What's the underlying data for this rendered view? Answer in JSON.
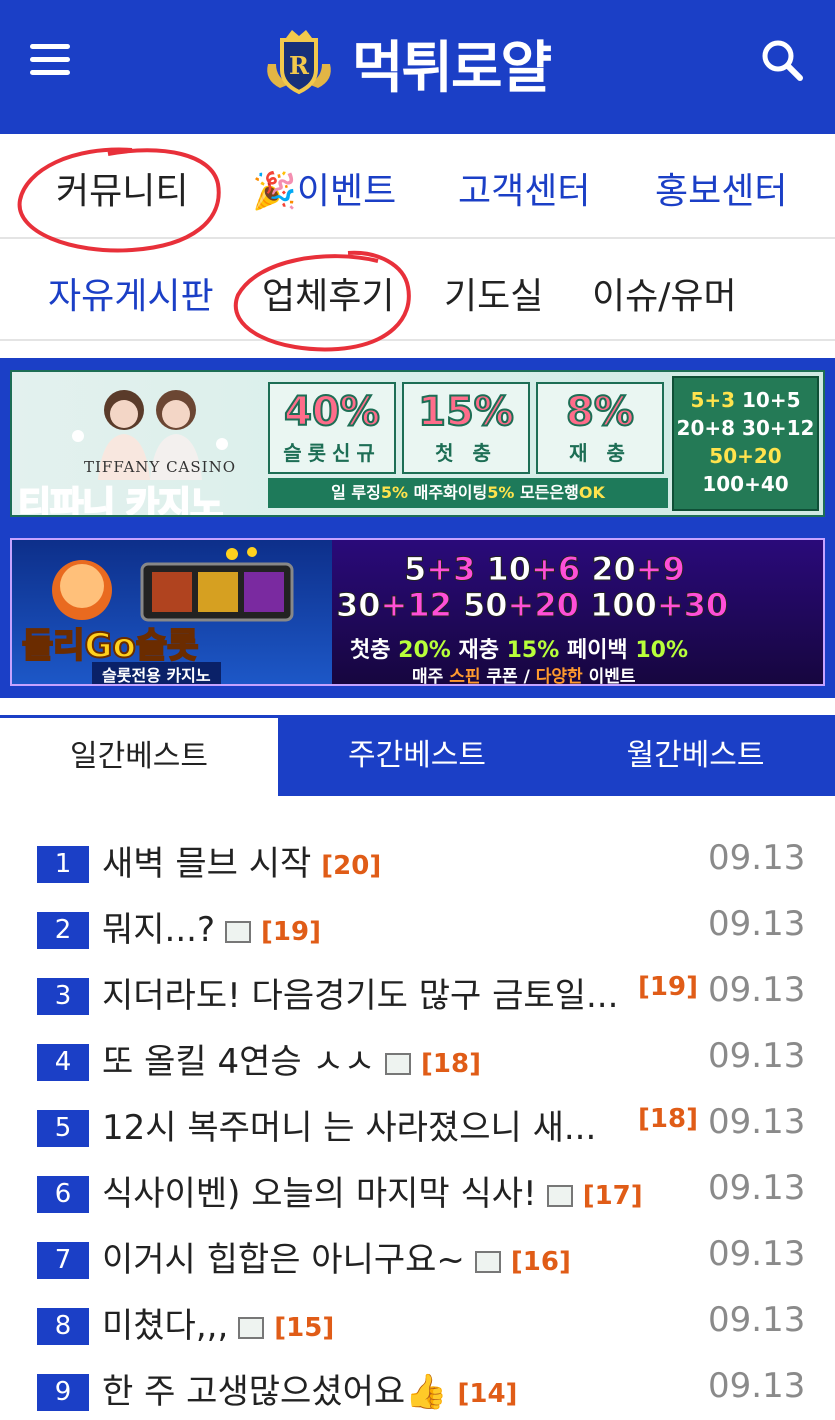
{
  "header": {
    "logo_text": "먹튀로얄",
    "logo_letter": "R",
    "menu_icon": "hamburger-menu-icon",
    "search_icon": "search-icon",
    "bg_color": "#1b3fc6"
  },
  "nav_primary": [
    {
      "label": "커뮤니티",
      "active": true
    },
    {
      "label": "🎉이벤트",
      "active": false
    },
    {
      "label": "고객센터",
      "active": false
    },
    {
      "label": "홍보센터",
      "active": false
    }
  ],
  "nav_secondary": [
    {
      "label": "자유게시판",
      "active": true
    },
    {
      "label": "업체후기",
      "active": false
    },
    {
      "label": "기도실",
      "active": false
    },
    {
      "label": "이슈/유머",
      "active": false
    }
  ],
  "banners": {
    "tiffany": {
      "brand": "TIFFANY CASINO",
      "name": "티파니 카지노",
      "boxes": [
        {
          "pct": "40%",
          "label": "슬롯신규"
        },
        {
          "pct": "15%",
          "label": "첫 충"
        },
        {
          "pct": "8%",
          "label": "재 충"
        }
      ],
      "strip_parts": [
        "일 루징",
        "5%",
        " 매주화이팅",
        "5%",
        " 모든은행",
        "OK"
      ],
      "bonus": [
        {
          "a": "5+3",
          "b": "10+5"
        },
        {
          "a": "20+8",
          "b": "30+12"
        },
        {
          "a": "50+20",
          "b": ""
        },
        {
          "a": "100+40",
          "b": ""
        }
      ]
    },
    "dolligo": {
      "name": "돌리Go슬롯",
      "sub": "슬롯전용 카지노",
      "row1": [
        "5+3",
        "10+6",
        "20+9"
      ],
      "row2": [
        "30+12",
        "50+20",
        "100+30"
      ],
      "row3_parts": [
        "첫충 ",
        "20%",
        " 재충 ",
        "15%",
        " 페이백 ",
        "10%"
      ],
      "row4_parts": [
        "매주 ",
        "스핀",
        " 쿠폰 / ",
        "다양한",
        " 이벤트"
      ]
    }
  },
  "tabs": [
    {
      "label": "일간베스트",
      "active": true
    },
    {
      "label": "주간베스트",
      "active": false
    },
    {
      "label": "월간베스트",
      "active": false
    }
  ],
  "best_list": [
    {
      "rank": "1",
      "title": "새벽 믈브 시작",
      "has_image": false,
      "comments": "[20]",
      "date": "09.13"
    },
    {
      "rank": "2",
      "title": "뭐지...?",
      "has_image": true,
      "comments": "[19]",
      "date": "09.13"
    },
    {
      "rank": "3",
      "title": "지더라도! 다음경기도 많구 금토일...",
      "has_image": false,
      "comments": "[19]",
      "date": "09.13"
    },
    {
      "rank": "4",
      "title": "또 올킬 4연승 ㅅㅅ",
      "has_image": true,
      "comments": "[18]",
      "date": "09.13"
    },
    {
      "rank": "5",
      "title": "12시 복주머니 는 사라졌으니 새...",
      "has_image": false,
      "comments": "[18]",
      "date": "09.13"
    },
    {
      "rank": "6",
      "title": "식사이벤) 오늘의 마지막 식사!",
      "has_image": true,
      "comments": "[17]",
      "date": "09.13"
    },
    {
      "rank": "7",
      "title": "이거시 힙합은 아니구요~",
      "has_image": true,
      "comments": "[16]",
      "date": "09.13"
    },
    {
      "rank": "8",
      "title": "미쳤다,,,",
      "has_image": true,
      "comments": "[15]",
      "date": "09.13"
    },
    {
      "rank": "9",
      "title": "한 주 고생많으셨어요👍",
      "has_image": false,
      "comments": "[14]",
      "date": "09.13"
    }
  ]
}
